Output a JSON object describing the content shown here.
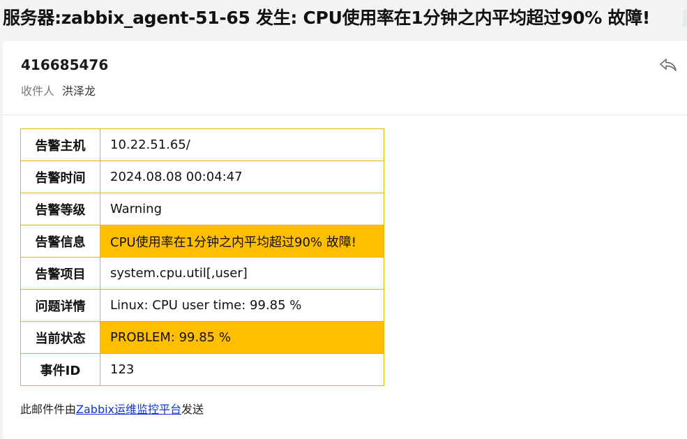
{
  "subject": "服务器:zabbix_agent-51-65 发生: CPU使用率在1分钟之内平均超过90% 故障!",
  "message": {
    "sender": "416685476",
    "recipient_label": "收件人",
    "recipient_name": "洪泽龙",
    "reply_icon": "reply-icon"
  },
  "alert_table": [
    {
      "key": "告警主机",
      "value": "10.22.51.65/"
    },
    {
      "key": "告警时间",
      "value": "2024.08.08 00:04:47"
    },
    {
      "key": "告警等级",
      "value": "Warning"
    },
    {
      "key": "告警信息",
      "value": "CPU使用率在1分钟之内平均超过90% 故障!"
    },
    {
      "key": "告警项目",
      "value": "system.cpu.util[,user]"
    },
    {
      "key": "问题详情",
      "value": "Linux: CPU user time: 99.85 %"
    },
    {
      "key": "当前状态",
      "value": "PROBLEM: 99.85 %"
    },
    {
      "key": "事件ID",
      "value": "123"
    }
  ],
  "footer": {
    "prefix": "此邮件件由",
    "link": "Zabbix运维监控平台",
    "suffix": "发送"
  },
  "colors": {
    "highlight": "#ffbf00",
    "table_border": "#f0b400",
    "link": "#0b35d6"
  }
}
